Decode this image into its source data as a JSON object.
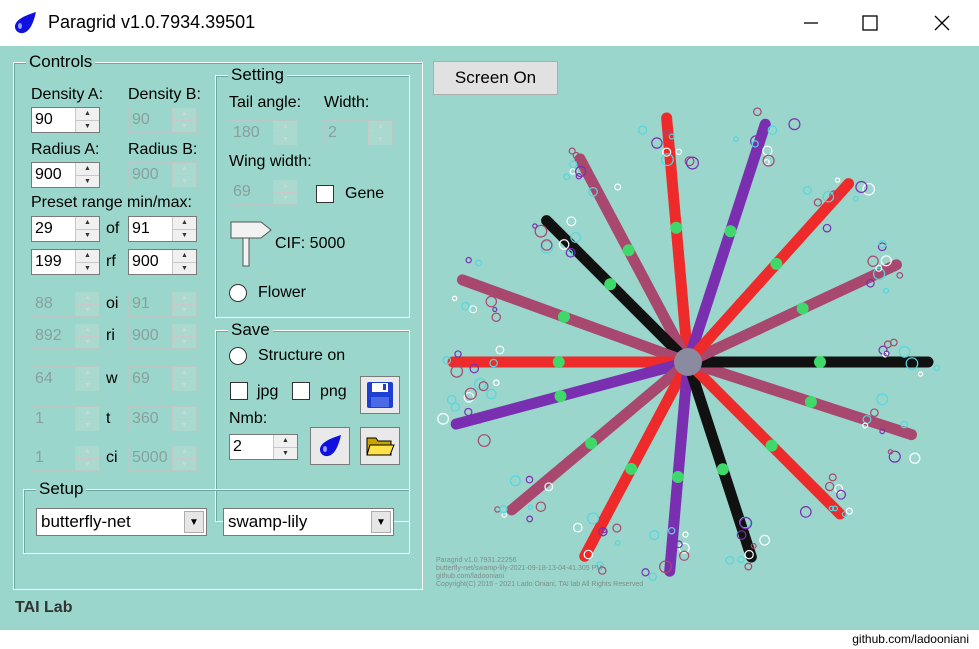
{
  "window": {
    "title": "Paragrid v1.0.7934.39501",
    "minimize_glyph": "─",
    "maximize_glyph": "☐",
    "close_glyph": "✕"
  },
  "controls": {
    "title": "Controls",
    "density_a_label": "Density A:",
    "density_b_label": "Density B:",
    "density_a": "90",
    "density_b": "90",
    "radius_a_label": "Radius A:",
    "radius_b_label": "Radius B:",
    "radius_a": "900",
    "radius_b": "900",
    "preset_label": "Preset range min/max:",
    "rows": [
      {
        "left": "29",
        "mid": "of",
        "right": "91"
      },
      {
        "left": "199",
        "mid": "rf",
        "right": "900"
      },
      {
        "left": "88",
        "mid": "oi",
        "right": "91"
      },
      {
        "left": "892",
        "mid": "ri",
        "right": "900"
      },
      {
        "left": "64",
        "mid": "w",
        "right": "69"
      },
      {
        "left": "1",
        "mid": "t",
        "right": "360"
      },
      {
        "left": "1",
        "mid": "ci",
        "right": "5000"
      }
    ]
  },
  "setting": {
    "title": "Setting",
    "tail_angle_label": "Tail angle:",
    "width_label": "Width:",
    "tail_angle": "180",
    "width": "2",
    "wing_width_label": "Wing width:",
    "wing_width": "69",
    "gene_label": "Gene",
    "cif_label": "CIF: 5000",
    "flower_label": "Flower"
  },
  "save": {
    "title": "Save",
    "structure_label": "Structure on",
    "jpg_label": "jpg",
    "png_label": "png",
    "nmb_label": "Nmb:",
    "nmb": "2"
  },
  "setup": {
    "title": "Setup",
    "combo1": "butterfly-net",
    "combo2": "swamp-lily"
  },
  "screen_button": "Screen On",
  "brand": "TAI Lab",
  "canvas_info": [
    "Paragrid v1.0.7931.22256",
    "butterfly-net/swamp-lily-2021-09-18-13-04-41.305 PM",
    "github.com/ladooniani",
    "Copyright(C) 2016 - 2021 Lado Oniani, TAI lab All Rights Reserved"
  ],
  "footer_credit": "github.com/ladooniani",
  "colors": {
    "background": "#9ad6cb",
    "red": "#ee2a2a",
    "purple": "#7a2fb0",
    "mauve": "#a8486e",
    "black": "#111111",
    "cyan": "#56d6df",
    "green": "#3fd86a",
    "center": "#8a8aa0"
  },
  "icons": [
    "app-drop-icon",
    "save-disk-icon",
    "drop-icon",
    "folder-icon"
  ]
}
